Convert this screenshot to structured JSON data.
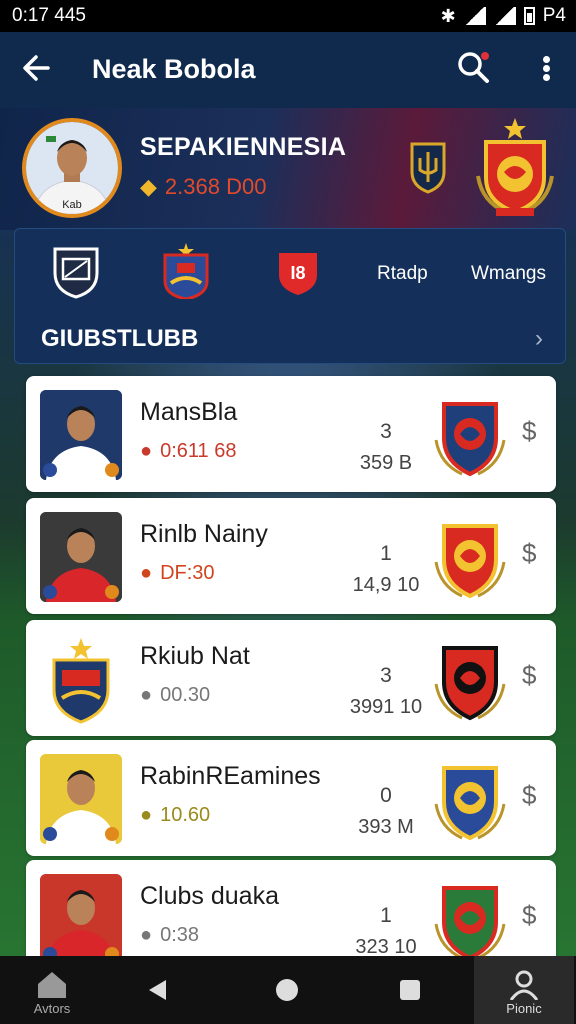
{
  "status": {
    "time": "0:17 445",
    "right_text": "P4"
  },
  "appbar": {
    "title": "Neak Bobola"
  },
  "hero": {
    "team_name": "SEPAKIENNESIA",
    "stat_value": "2.368 D00",
    "avatar_shirt_text": "Kab"
  },
  "clubstrip": {
    "items": [
      "Rtadp",
      "Wmangs"
    ],
    "logo3_text": "I8",
    "label": "GIUBSTLUBB"
  },
  "list": [
    {
      "name": "MansBla",
      "meta": "0:611 68",
      "meta_color": "#c93a2c",
      "n1": "3",
      "n2": "359 B",
      "jersey": "#ffffff",
      "bg": "#1f3a6a"
    },
    {
      "name": "Rinlb Nainy",
      "meta": "DF:30",
      "meta_color": "#d1451e",
      "n1": "1",
      "n2": "14,9 10",
      "jersey": "#d8262a",
      "bg": "#3a3a3a"
    },
    {
      "name": "Rkiub Nat",
      "meta": "00.30",
      "meta_color": "#777777",
      "n1": "3",
      "n2": "3991 10",
      "jersey": "",
      "bg": ""
    },
    {
      "name": "RabinREamines",
      "meta": "10.60",
      "meta_color": "#9a8b1d",
      "n1": "0",
      "n2": "393 M",
      "jersey": "#ffffff",
      "bg": "#e9c83a"
    },
    {
      "name": "Clubs duaka",
      "meta": "0:38",
      "meta_color": "#777777",
      "n1": "1",
      "n2": "323 10",
      "jersey": "#d8262a",
      "bg": "#c8372a"
    }
  ],
  "nav": {
    "left_label": "Avtors",
    "right_label": "Pionic"
  },
  "colors": {
    "accent": "#e08a1e",
    "appbar": "#0f2a4d",
    "panel": "#14305a"
  }
}
